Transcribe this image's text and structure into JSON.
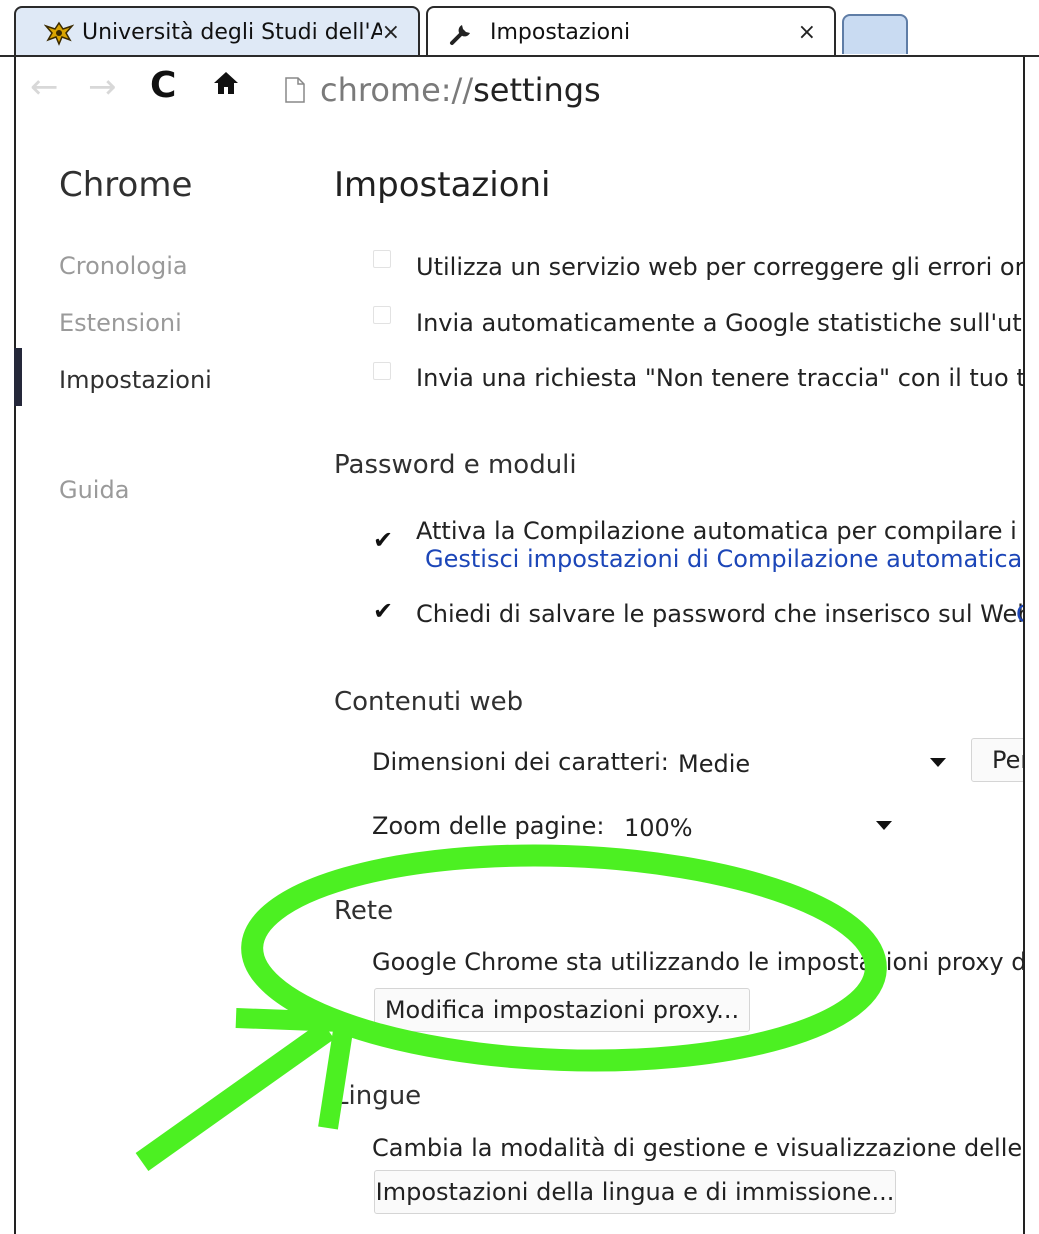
{
  "browser": {
    "tabs": [
      {
        "title": "Università degli Studi dell'Aq",
        "close": "×"
      },
      {
        "title": "Impostazioni",
        "close": "×"
      }
    ],
    "url_scheme": "chrome://",
    "url_path": "settings"
  },
  "sidebar": {
    "title": "Chrome",
    "items": [
      {
        "label": "Cronologia"
      },
      {
        "label": "Estensioni"
      },
      {
        "label": "Impostazioni"
      },
      {
        "label": "Guida"
      }
    ]
  },
  "main": {
    "title": "Impostazioni",
    "privacy_checkboxes": [
      {
        "label": "Utilizza un servizio web per correggere gli errori ortogr",
        "checked": false
      },
      {
        "label": "Invia automaticamente a Google statistiche sull'utilizzo",
        "checked": false
      },
      {
        "label": "Invia una richiesta \"Non tenere traccia\" con il tuo traf",
        "checked": false
      }
    ],
    "passwords": {
      "title": "Password e moduli",
      "autofill_label": "Attiva la Compilazione automatica per compilare i mod",
      "autofill_link": "Gestisci impostazioni di Compilazione automatica",
      "save_pw_label": "Chiedi di salvare le password che inserisco sul Web.",
      "save_pw_link": "G"
    },
    "web_content": {
      "title": "Contenuti web",
      "font_size_label": "Dimensioni dei caratteri:",
      "font_size_value": "Medie",
      "customize_button": "Per",
      "zoom_label": "Zoom delle pagine:",
      "zoom_value": "100%"
    },
    "network": {
      "title": "Rete",
      "description": "Google Chrome sta utilizzando le impostazioni proxy di sist",
      "proxy_button": "Modifica impostazioni proxy..."
    },
    "languages": {
      "title": "Lingue",
      "description": "Cambia la modalità di gestione e visualizzazione delle lingue",
      "button": "Impostazioni della lingua e di immissione..."
    }
  },
  "annotation": {
    "color": "#4cf022"
  }
}
